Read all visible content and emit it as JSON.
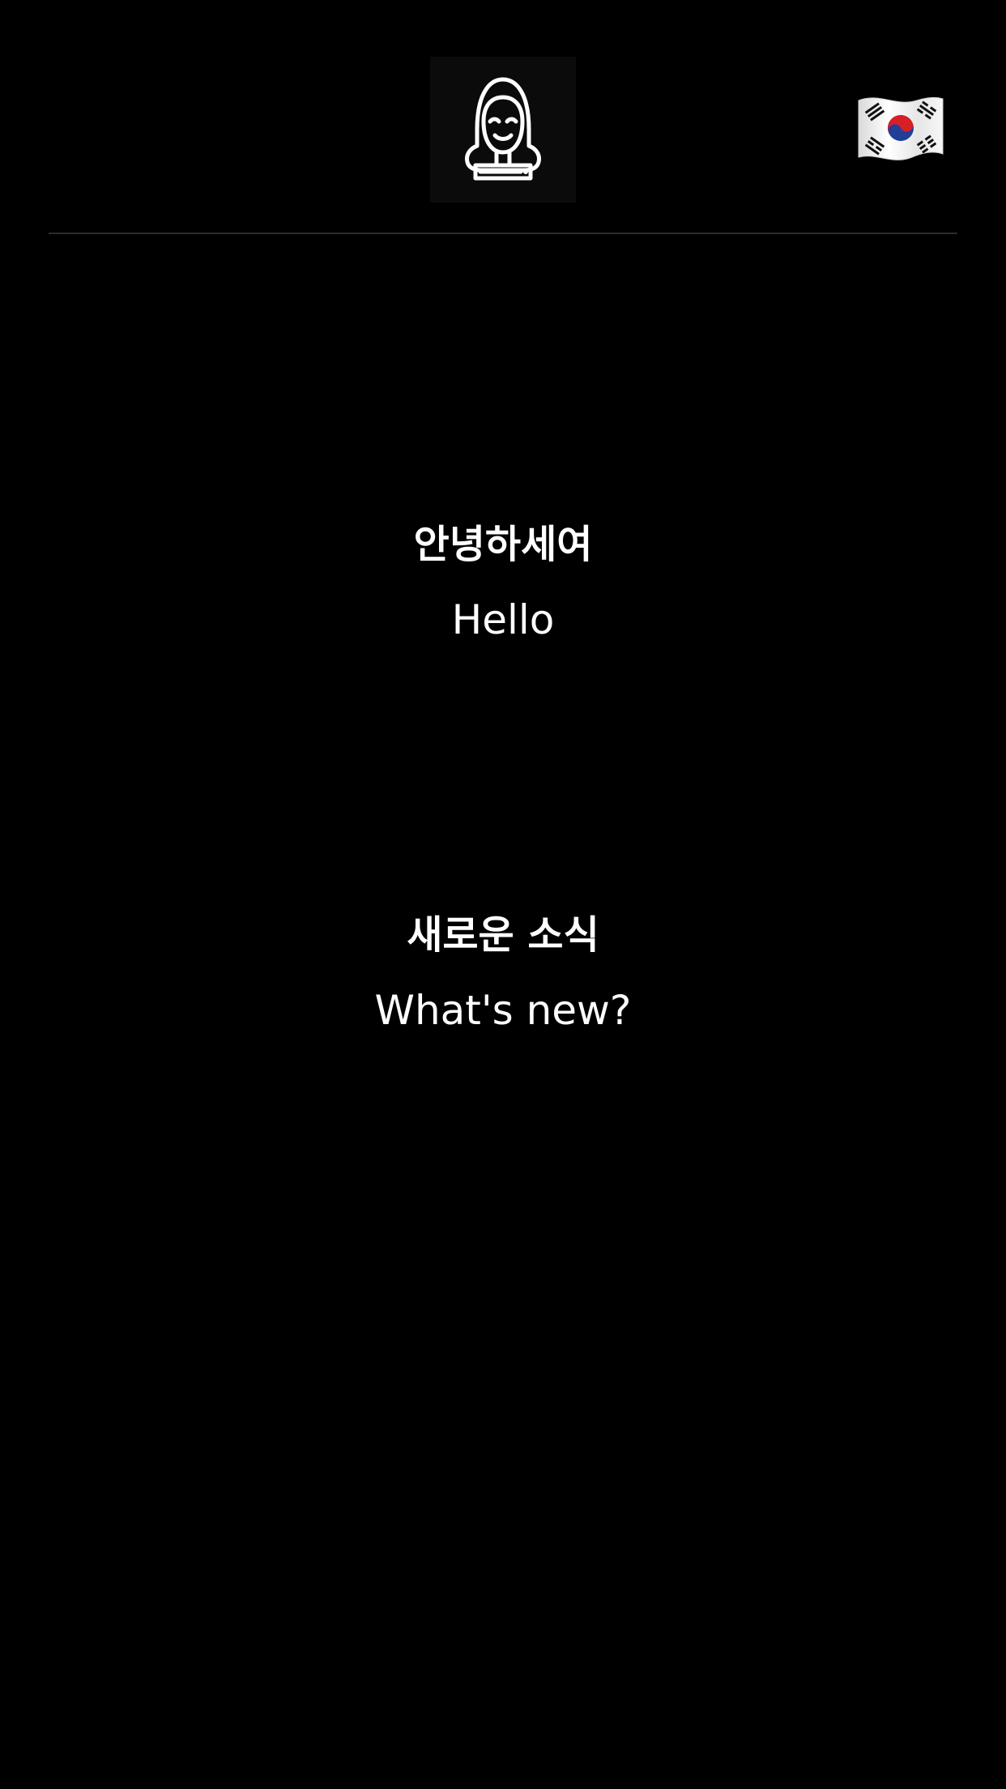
{
  "header": {
    "avatar_icon": "woman-face-icon",
    "language_flag": "south-korea-flag-icon"
  },
  "phrases": [
    {
      "native": "안녕하세여",
      "translation": "Hello"
    },
    {
      "native": "새로운 소식",
      "translation": "What's new?"
    }
  ],
  "colors": {
    "background": "#000000",
    "text": "#FFFFFF",
    "divider": "#2B2B2B"
  }
}
